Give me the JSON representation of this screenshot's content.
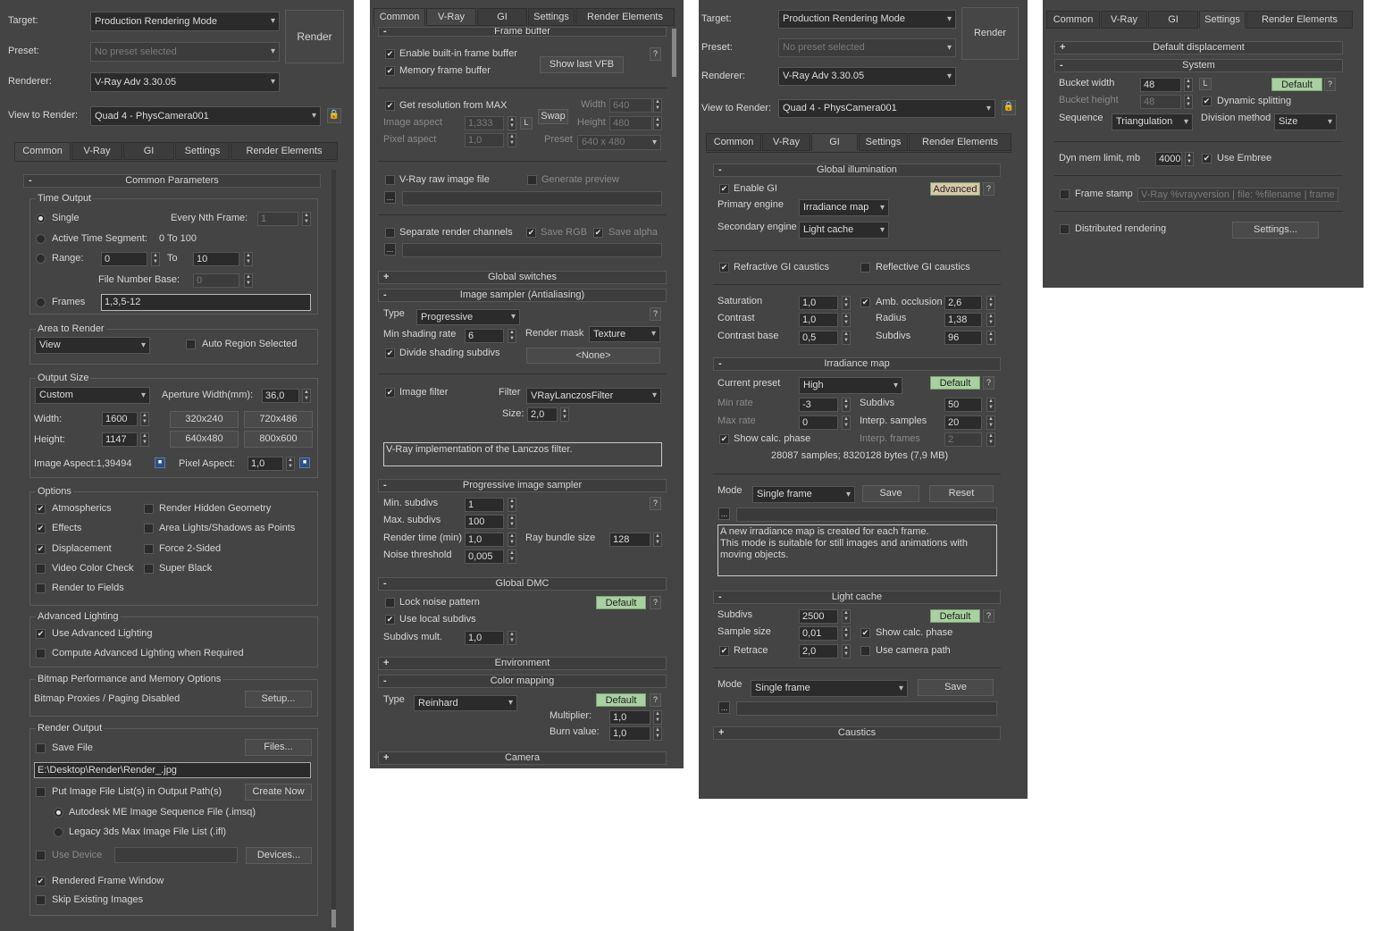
{
  "panel1": {
    "target_label": "Target:",
    "target_value": "Production Rendering Mode",
    "preset_label": "Preset:",
    "preset_value": "No preset selected",
    "renderer_label": "Renderer:",
    "renderer_value": "V-Ray Adv 3.30.05",
    "view_label": "View to Render:",
    "view_value": "Quad 4 - PhysCamera001",
    "render_button": "Render",
    "tabs": [
      "Common",
      "V-Ray",
      "GI",
      "Settings",
      "Render Elements"
    ],
    "rollout_title": "Common Parameters",
    "time_output": {
      "title": "Time Output",
      "single": "Single",
      "every_nth": "Every Nth Frame:",
      "every_nth_value": "1",
      "active_segment": "Active Time Segment:",
      "active_segment_value": "0 To 100",
      "range": "Range:",
      "range_from": "0",
      "to": "To",
      "range_to": "10",
      "file_number_base": "File Number Base:",
      "file_number_base_value": "0",
      "frames": "Frames",
      "frames_value": "1,3,5-12"
    },
    "area_to_render": {
      "title": "Area to Render",
      "value": "View",
      "auto_region": "Auto Region Selected"
    },
    "output_size": {
      "title": "Output Size",
      "preset": "Custom",
      "aperture_label": "Aperture Width(mm):",
      "aperture_value": "36,0",
      "width_label": "Width:",
      "width_value": "1600",
      "height_label": "Height:",
      "height_value": "1147",
      "presets": [
        "320x240",
        "720x486",
        "640x480",
        "800x600"
      ],
      "image_aspect": "Image Aspect:1,39494",
      "pixel_aspect_label": "Pixel Aspect:",
      "pixel_aspect_value": "1,0"
    },
    "options": {
      "title": "Options",
      "atmospherics": "Atmospherics",
      "render_hidden": "Render Hidden Geometry",
      "effects": "Effects",
      "area_lights": "Area Lights/Shadows as Points",
      "displacement": "Displacement",
      "force_2sided": "Force 2-Sided",
      "video_color": "Video Color Check",
      "super_black": "Super Black",
      "render_fields": "Render to Fields"
    },
    "advanced_lighting": {
      "title": "Advanced Lighting",
      "use": "Use Advanced Lighting",
      "compute": "Compute Advanced Lighting when Required"
    },
    "bitmap": {
      "title": "Bitmap Performance and Memory Options",
      "text": "Bitmap Proxies / Paging Disabled",
      "setup": "Setup..."
    },
    "render_output": {
      "title": "Render Output",
      "save_file": "Save File",
      "files": "Files...",
      "path": "E:\\Desktop\\Render\\Render_.jpg",
      "put_list": "Put Image File List(s) in Output Path(s)",
      "create_now": "Create Now",
      "autodesk": "Autodesk ME Image Sequence File (.imsq)",
      "legacy": "Legacy 3ds Max Image File List (.ifl)",
      "use_device": "Use Device",
      "devices": "Devices...",
      "rendered_frame": "Rendered Frame Window",
      "skip_existing": "Skip Existing Images"
    }
  },
  "panel2": {
    "tabs": [
      "Common",
      "V-Ray",
      "GI",
      "Settings",
      "Render Elements"
    ],
    "frame_buffer": {
      "title": "Frame buffer",
      "enable_builtin": "Enable built-in frame buffer",
      "memory_fb": "Memory frame buffer",
      "show_last": "Show last VFB",
      "get_resolution": "Get resolution from MAX",
      "width_label": "Width",
      "width_value": "640",
      "height_label": "Height",
      "height_value": "480",
      "image_aspect_label": "Image aspect",
      "image_aspect_value": "1,333",
      "l": "L",
      "swap": "Swap",
      "pixel_aspect_label": "Pixel aspect",
      "pixel_aspect_value": "1,0",
      "preset_label": "Preset",
      "preset_value": "640 x 480",
      "raw_file": "V-Ray raw image file",
      "gen_preview": "Generate preview",
      "sep_channels": "Separate render channels",
      "save_rgb": "Save RGB",
      "save_alpha": "Save alpha",
      "dots": "..."
    },
    "global_switches": "Global switches",
    "image_sampler": {
      "title": "Image sampler (Antialiasing)",
      "type_label": "Type",
      "type_value": "Progressive",
      "min_shading_label": "Min shading rate",
      "min_shading_value": "6",
      "render_mask_label": "Render mask",
      "render_mask_value": "Texture",
      "divide": "Divide shading subdivs",
      "none": "<None>"
    },
    "image_filter": {
      "label": "Image filter",
      "filter_label": "Filter",
      "filter_value": "VRayLanczosFilter",
      "size_label": "Size:",
      "size_value": "2,0",
      "desc": "V-Ray implementation of the Lanczos filter."
    },
    "progressive": {
      "title": "Progressive image sampler",
      "min_subdivs_label": "Min. subdivs",
      "min_subdivs_value": "1",
      "max_subdivs_label": "Max. subdivs",
      "max_subdivs_value": "100",
      "render_time_label": "Render time (min)",
      "render_time_value": "1,0",
      "bundle_label": "Ray bundle size",
      "bundle_value": "128",
      "noise_label": "Noise threshold",
      "noise_value": "0,005"
    },
    "dmc": {
      "title": "Global DMC",
      "lock_noise": "Lock noise pattern",
      "use_local": "Use local subdivs",
      "mult_label": "Subdivs mult.",
      "mult_value": "1,0",
      "default": "Default"
    },
    "environment": "Environment",
    "color_mapping": {
      "title": "Color mapping",
      "type_label": "Type",
      "type_value": "Reinhard",
      "default": "Default",
      "multiplier_label": "Multiplier:",
      "multiplier_value": "1,0",
      "burn_label": "Burn value:",
      "burn_value": "1,0"
    },
    "camera": "Camera"
  },
  "panel3": {
    "target_label": "Target:",
    "target_value": "Production Rendering Mode",
    "preset_label": "Preset:",
    "preset_value": "No preset selected",
    "renderer_label": "Renderer:",
    "renderer_value": "V-Ray Adv 3.30.05",
    "view_label": "View to Render:",
    "view_value": "Quad 4 - PhysCamera001",
    "render_button": "Render",
    "tabs": [
      "Common",
      "V-Ray",
      "GI",
      "Settings",
      "Render Elements"
    ],
    "gi": {
      "title": "Global illumination",
      "enable": "Enable GI",
      "advanced": "Advanced",
      "primary_label": "Primary engine",
      "primary_value": "Irradiance map",
      "secondary_label": "Secondary engine",
      "secondary_value": "Light cache",
      "refractive": "Refractive GI caustics",
      "reflective": "Reflective GI caustics",
      "saturation_label": "Saturation",
      "saturation_value": "1,0",
      "amb_occ": "Amb. occlusion",
      "amb_occ_value": "2,6",
      "contrast_label": "Contrast",
      "contrast_value": "1,0",
      "radius_label": "Radius",
      "radius_value": "1,38",
      "contrast_base_label": "Contrast base",
      "contrast_base_value": "0,5",
      "subdivs_label": "Subdivs",
      "subdivs_value": "96"
    },
    "irradiance": {
      "title": "Irradiance map",
      "preset_label": "Current preset",
      "preset_value": "High",
      "default": "Default",
      "min_rate_label": "Min rate",
      "min_rate_value": "-3",
      "subdivs_label": "Subdivs",
      "subdivs_value": "50",
      "max_rate_label": "Max rate",
      "max_rate_value": "0",
      "interp_label": "Interp. samples",
      "interp_value": "20",
      "show_calc": "Show calc. phase",
      "interp_frames_label": "Interp. frames",
      "interp_frames_value": "2",
      "samples_info": "28087 samples; 8320128 bytes (7,9 MB)",
      "mode_label": "Mode",
      "mode_value": "Single frame",
      "save": "Save",
      "reset": "Reset",
      "desc": "A new irradiance map is created for each frame.\nThis mode is suitable for still images and animations with moving objects."
    },
    "light_cache": {
      "title": "Light cache",
      "subdivs_label": "Subdivs",
      "subdivs_value": "2500",
      "default": "Default",
      "sample_label": "Sample size",
      "sample_value": "0,01",
      "show_calc": "Show calc. phase",
      "retrace": "Retrace",
      "retrace_value": "2,0",
      "camera_path": "Use camera path",
      "mode_label": "Mode",
      "mode_value": "Single frame",
      "save": "Save"
    },
    "caustics": "Caustics"
  },
  "panel4": {
    "tabs": [
      "Common",
      "V-Ray",
      "GI",
      "Settings",
      "Render Elements"
    ],
    "default_displacement": "Default displacement",
    "system": {
      "title": "System",
      "bucket_width_label": "Bucket width",
      "bucket_width_value": "48",
      "l": "L",
      "default": "Default",
      "bucket_height_label": "Bucket height",
      "bucket_height_value": "48",
      "dynamic": "Dynamic splitting",
      "sequence_label": "Sequence",
      "sequence_value": "Triangulation",
      "division_label": "Division method",
      "division_value": "Size",
      "dyn_mem_label": "Dyn mem limit, mb",
      "dyn_mem_value": "4000",
      "embree": "Use Embree",
      "frame_stamp": "Frame stamp",
      "frame_stamp_value": "V-Ray %vrayversion | file: %filename | frame",
      "distributed": "Distributed rendering",
      "settings": "Settings..."
    }
  }
}
